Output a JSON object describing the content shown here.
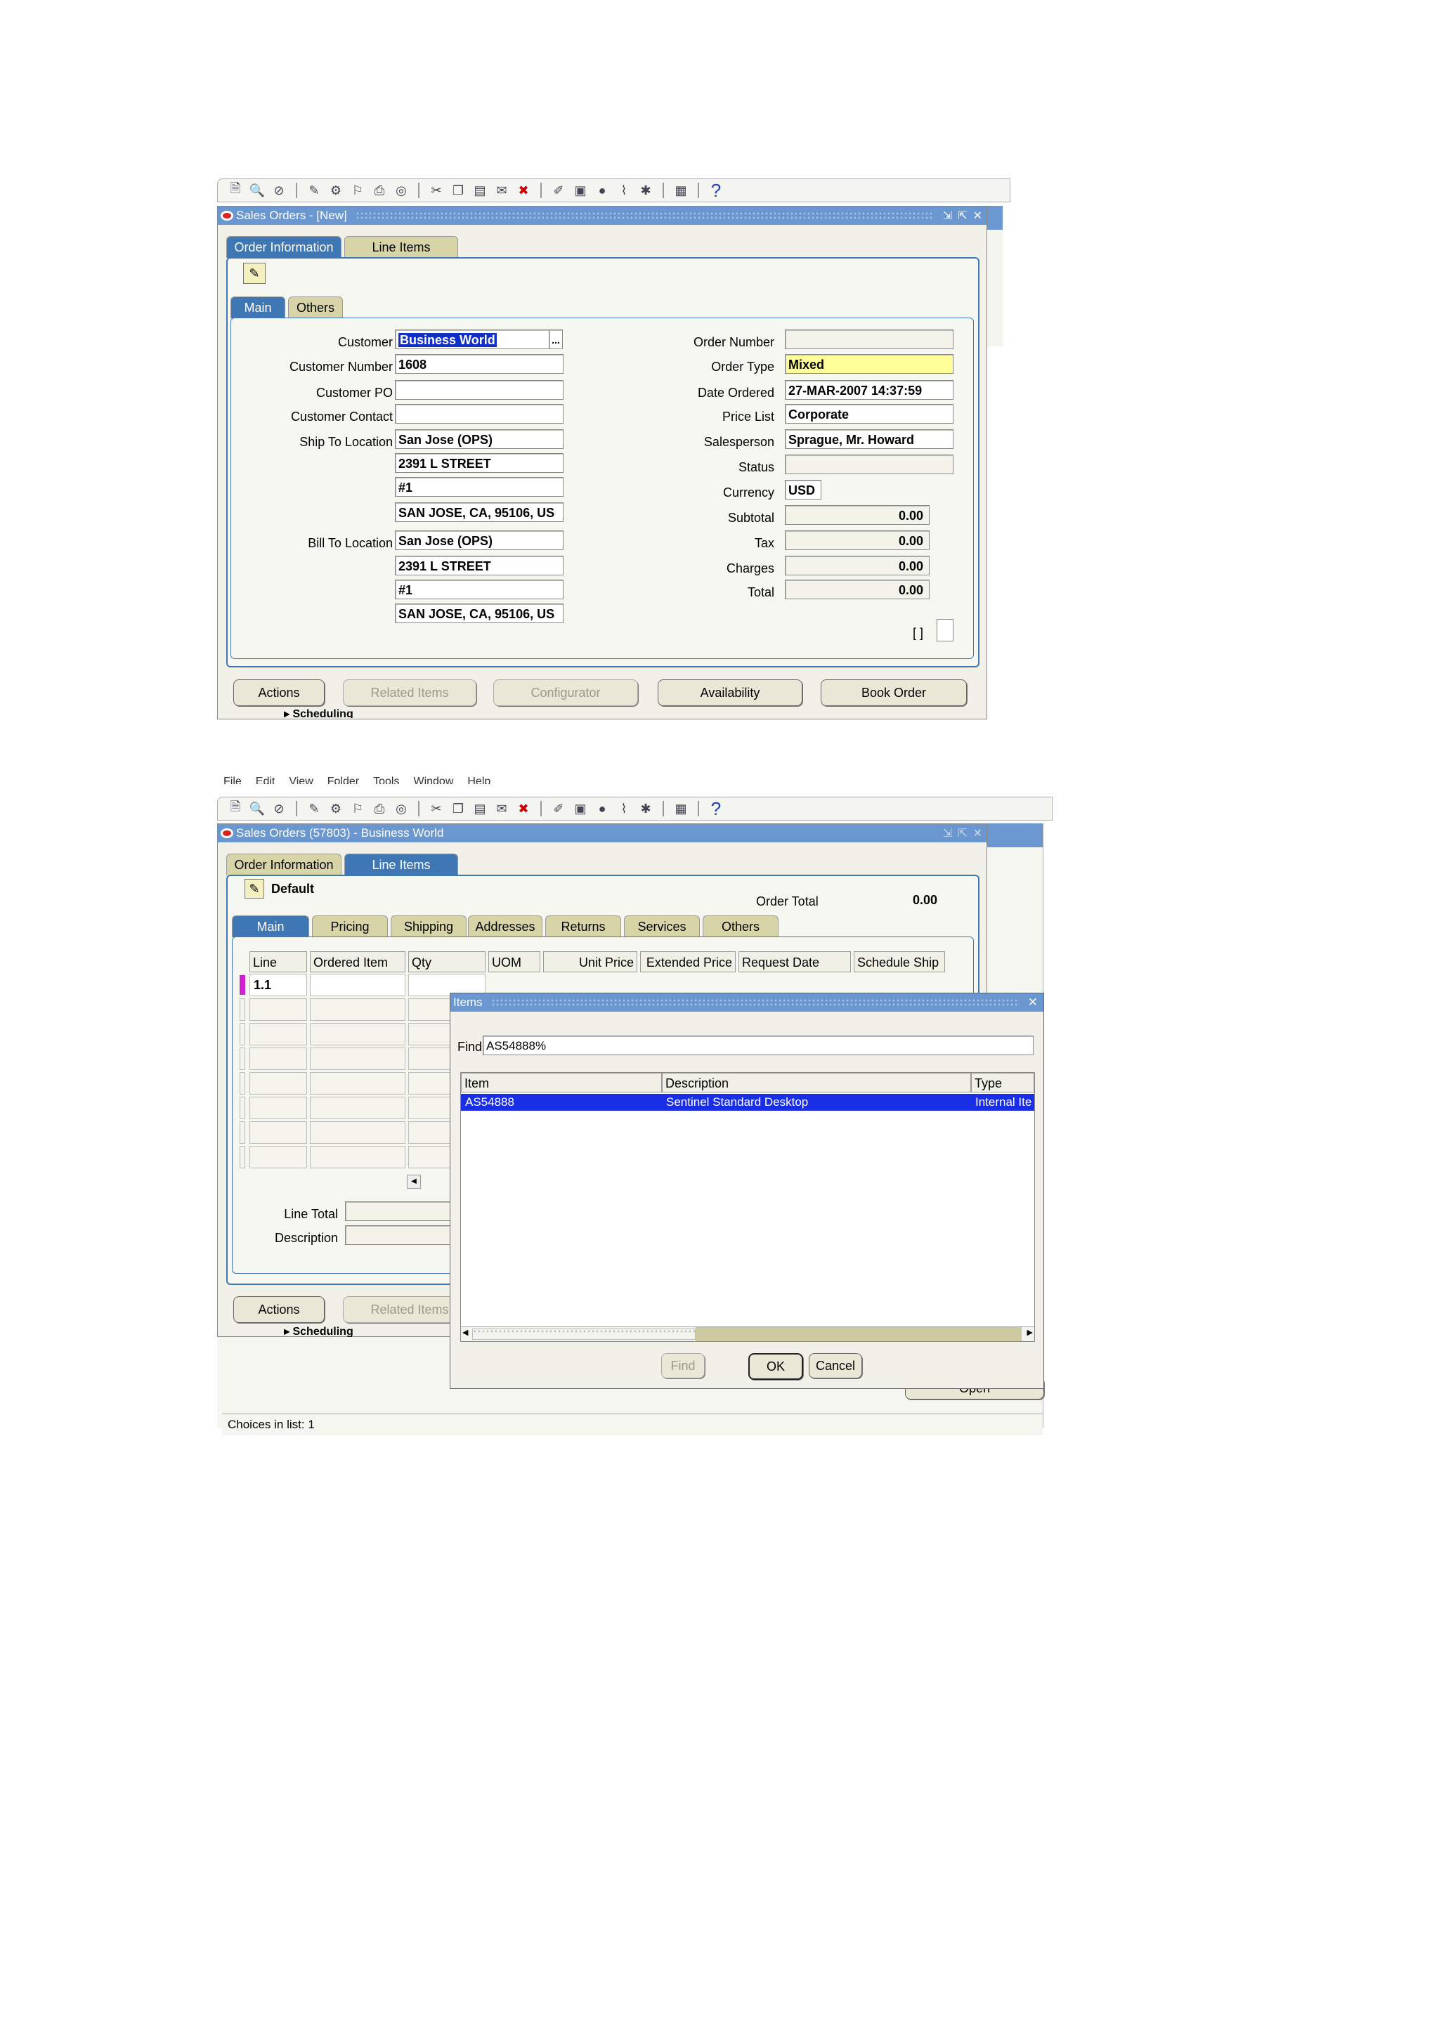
{
  "toolbar_icons": [
    "new-icon",
    "find-icon",
    "navigator-icon",
    "save-icon",
    "next-step-icon",
    "switch-responsibility-icon",
    "print-icon",
    "close-form-icon",
    "cut-icon",
    "copy-icon",
    "paste-icon",
    "clear-record-icon",
    "delete-record-icon",
    "edit-field-icon",
    "zoom-icon",
    "translations-icon",
    "attachments-icon",
    "folder-tools-icon",
    "window-help-icon",
    "help-icon"
  ],
  "help_glyph": "?",
  "screen1": {
    "window_title": "Sales Orders - [New]",
    "tabs": {
      "order_information": "Order Information",
      "line_items": "Line Items"
    },
    "subtabs": {
      "main": "Main",
      "others": "Others"
    },
    "labels": {
      "customer": "Customer",
      "customer_number": "Customer Number",
      "customer_po": "Customer PO",
      "customer_contact": "Customer Contact",
      "ship_to_location": "Ship To Location",
      "bill_to_location": "Bill To Location",
      "order_number": "Order Number",
      "order_type": "Order Type",
      "date_ordered": "Date Ordered",
      "price_list": "Price List",
      "salesperson": "Salesperson",
      "status": "Status",
      "currency": "Currency",
      "subtotal": "Subtotal",
      "tax": "Tax",
      "charges": "Charges",
      "total": "Total"
    },
    "values": {
      "customer": "Business World",
      "customer_number": "1608",
      "customer_po": "",
      "customer_contact": "",
      "ship_to": [
        "San Jose (OPS)",
        "2391 L STREET",
        "#1",
        "SAN JOSE, CA, 95106, US"
      ],
      "bill_to": [
        "San Jose (OPS)",
        "2391 L STREET",
        "#1",
        "SAN JOSE, CA, 95106, US"
      ],
      "order_number": "",
      "order_type": "Mixed",
      "date_ordered": "27-MAR-2007 14:37:59",
      "price_list": "Corporate",
      "salesperson": "Sprague, Mr. Howard",
      "status": "",
      "currency": "USD",
      "subtotal": "0.00",
      "tax": "0.00",
      "charges": "0.00",
      "total": "0.00"
    },
    "lov_button": "...",
    "dff_bracket": "[ ]",
    "buttons": {
      "actions": "Actions",
      "related_items": "Related Items",
      "configurator": "Configurator",
      "availability": "Availability",
      "book_order": "Book Order"
    },
    "scheduling": "Scheduling"
  },
  "screen2": {
    "menu": [
      "File",
      "Edit",
      "View",
      "Folder",
      "Tools",
      "Window",
      "Help"
    ],
    "window_title": "Sales Orders (57803) - Business World",
    "tabs": {
      "order_information": "Order Information",
      "line_items": "Line Items"
    },
    "default_label": "Default",
    "order_total_label": "Order Total",
    "order_total_value": "0.00",
    "subtabs": [
      "Main",
      "Pricing",
      "Shipping",
      "Addresses",
      "Returns",
      "Services",
      "Others"
    ],
    "columns": [
      "Line",
      "Ordered Item",
      "Qty",
      "UOM",
      "Unit Price",
      "Extended Price",
      "Request Date",
      "Schedule Ship"
    ],
    "first_line": "1.1",
    "line_total_label": "Line Total",
    "description_label": "Description",
    "buttons": {
      "actions": "Actions",
      "related_items": "Related Items"
    },
    "scheduling": "Scheduling",
    "open_button": "Open",
    "status_bar": "Choices in list: 1",
    "items_dialog": {
      "title": "Items",
      "find_label": "Find",
      "find_value": "AS54888%",
      "columns": [
        "Item",
        "Description",
        "Type"
      ],
      "rows": [
        {
          "item": "AS54888",
          "description": "Sentinel Standard Desktop",
          "type": "Internal Ite"
        }
      ],
      "buttons": {
        "find": "Find",
        "ok": "OK",
        "cancel": "Cancel"
      }
    }
  }
}
